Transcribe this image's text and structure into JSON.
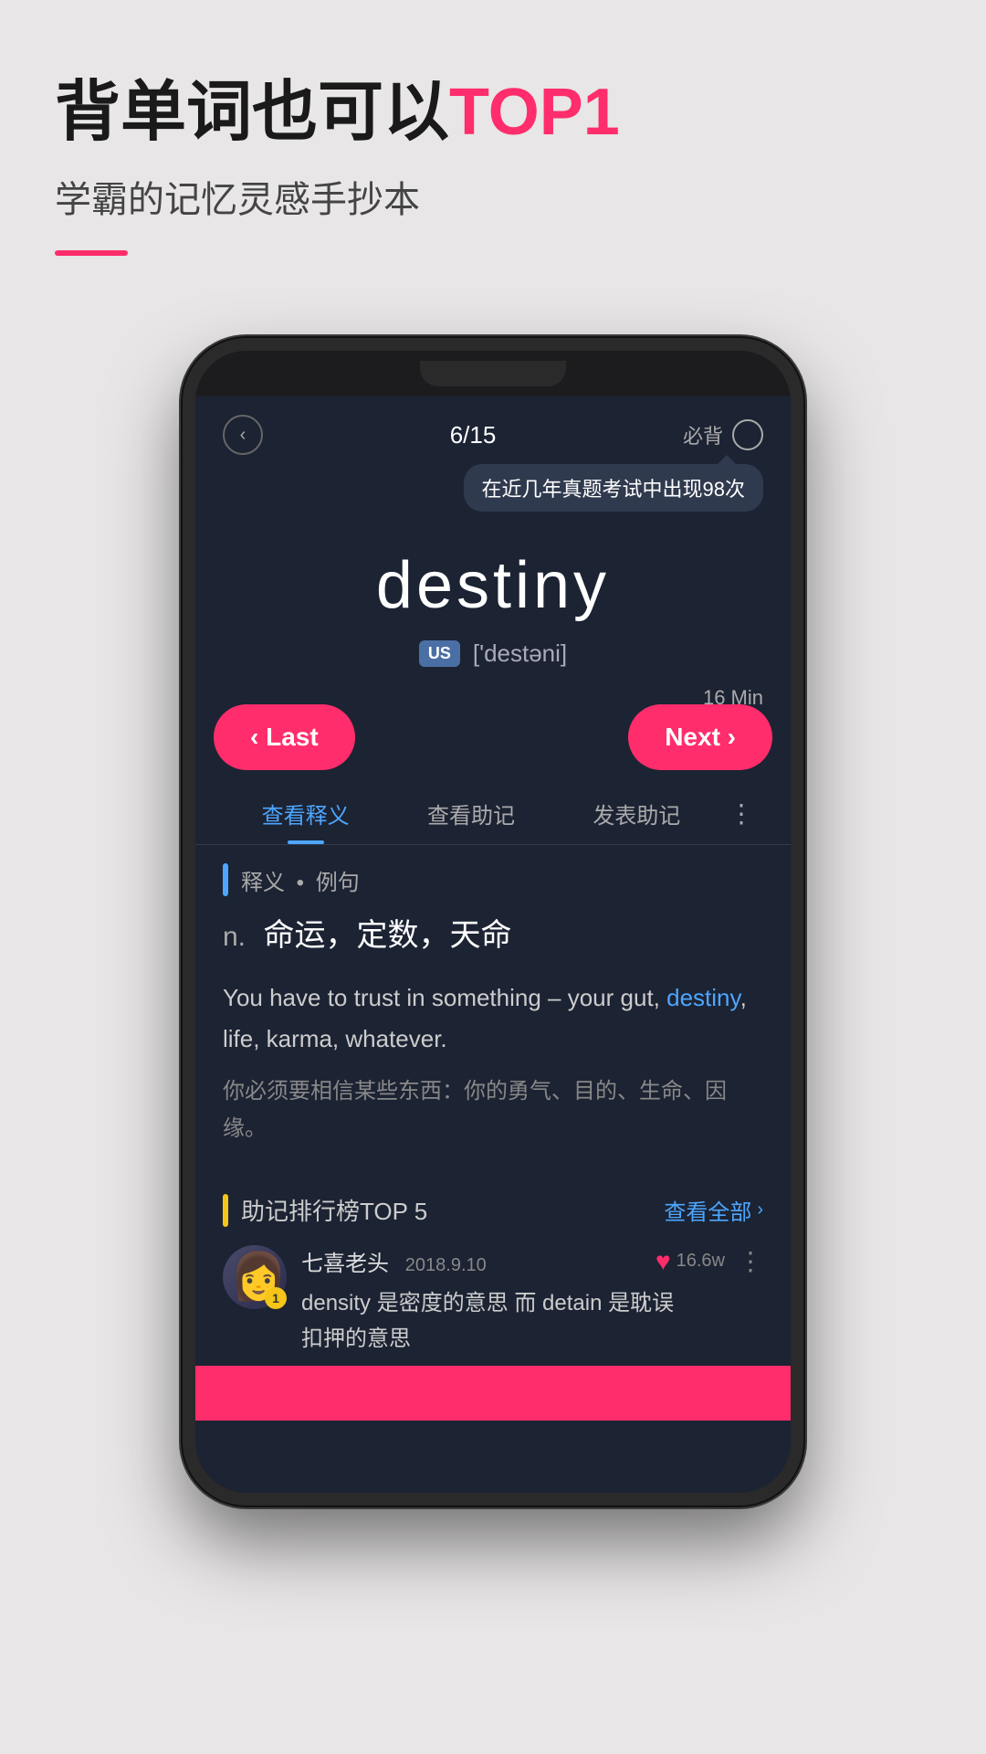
{
  "banner": {
    "title_part1": "背单词也可以",
    "title_highlight": "TOP1",
    "subtitle": "学霸的记忆灵感手抄本",
    "divider": true
  },
  "phone": {
    "nav": {
      "back_icon": "‹",
      "progress": "6/15",
      "must_label": "必背"
    },
    "tooltip": {
      "text": "在近几年真题考试中出现98次"
    },
    "word": {
      "text": "destiny",
      "us_label": "US",
      "phonetic": "['destəni]"
    },
    "controls": {
      "timer": "16 Min",
      "last_btn": "‹ Last",
      "next_btn": "Next ›"
    },
    "tabs": [
      {
        "label": "查看释义",
        "active": true
      },
      {
        "label": "查看助记",
        "active": false
      },
      {
        "label": "发表助记",
        "active": false
      }
    ],
    "tabs_more": "⋮",
    "definition": {
      "section_label": "释义",
      "section_sublabel": "例句",
      "pos": "n.",
      "meaning": "命运，定数，天命",
      "example_en_prefix": "You have to trust in something –\nyour gut, ",
      "example_en_keyword": "destiny",
      "example_en_suffix": ", life, karma, whatever.",
      "example_zh": "你必须要相信某些东西：你的勇气、目的、生命、因缘。"
    },
    "mnemonic": {
      "section_label": "助记排行榜TOP 5",
      "view_all_label": "查看全部",
      "user": {
        "name": "七喜老头",
        "date": "2018.9.10",
        "badge": "1",
        "like_count": "16.6w",
        "content_prefix": "density 是密度的意思 而 detain 是耽误\n扣押的意思"
      }
    }
  }
}
